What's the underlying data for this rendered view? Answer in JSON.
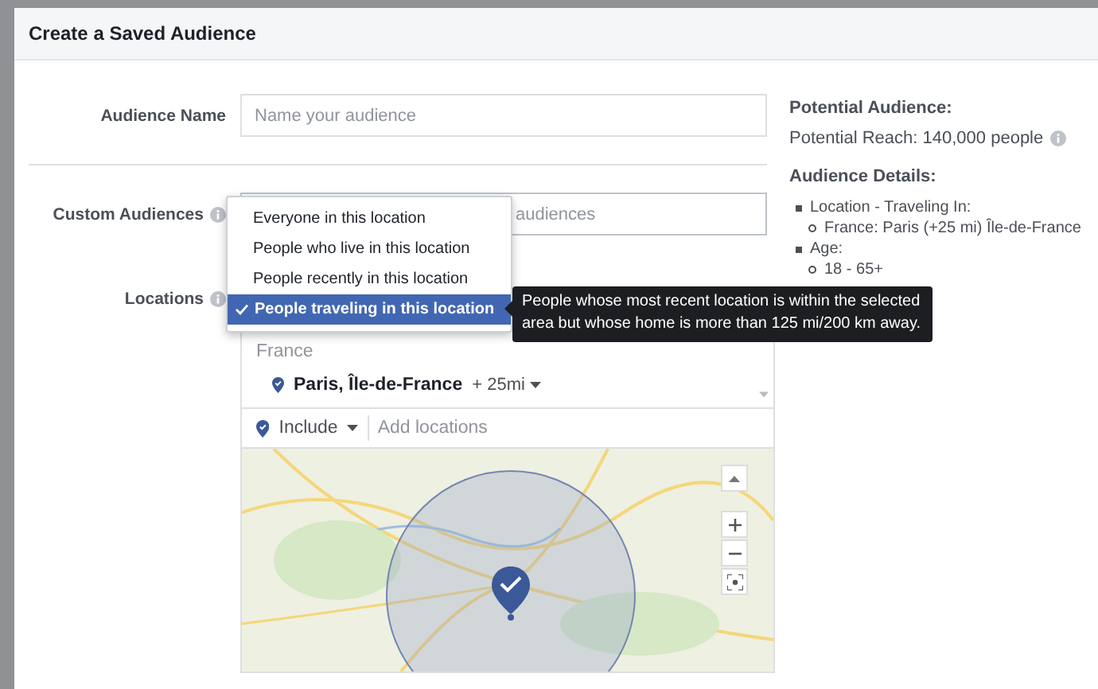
{
  "dialog": {
    "title": "Create a Saved Audience"
  },
  "form": {
    "audience_name": {
      "label": "Audience Name",
      "placeholder": "Name your audience"
    },
    "custom_audiences": {
      "label": "Custom Audiences",
      "placeholder": "audiences"
    },
    "locations": {
      "label": "Locations",
      "group": "France",
      "items": [
        {
          "name": "Paris, Île-de-France",
          "radius": "+ 25mi"
        }
      ],
      "include": "Include",
      "placeholder": "Add locations"
    }
  },
  "location_type_menu": {
    "options": [
      {
        "label": "Everyone in this location",
        "selected": false
      },
      {
        "label": "People who live in this location",
        "selected": false
      },
      {
        "label": "People recently in this location",
        "selected": false
      },
      {
        "label": "People traveling in this location",
        "selected": true
      }
    ]
  },
  "tooltip": {
    "text": "People whose most recent location is within the selected area but whose home is more than 125 mi/200 km away."
  },
  "summary": {
    "title": "Potential Audience:",
    "reach": "Potential Reach: 140,000 people",
    "details_title": "Audience Details:",
    "details": [
      {
        "text": "Location - Traveling In:",
        "children": [
          {
            "text": "France: Paris (+25 mi) Île-de-France"
          }
        ]
      },
      {
        "text": "Age:",
        "children": [
          {
            "text": "18 - 65+"
          }
        ]
      }
    ]
  }
}
